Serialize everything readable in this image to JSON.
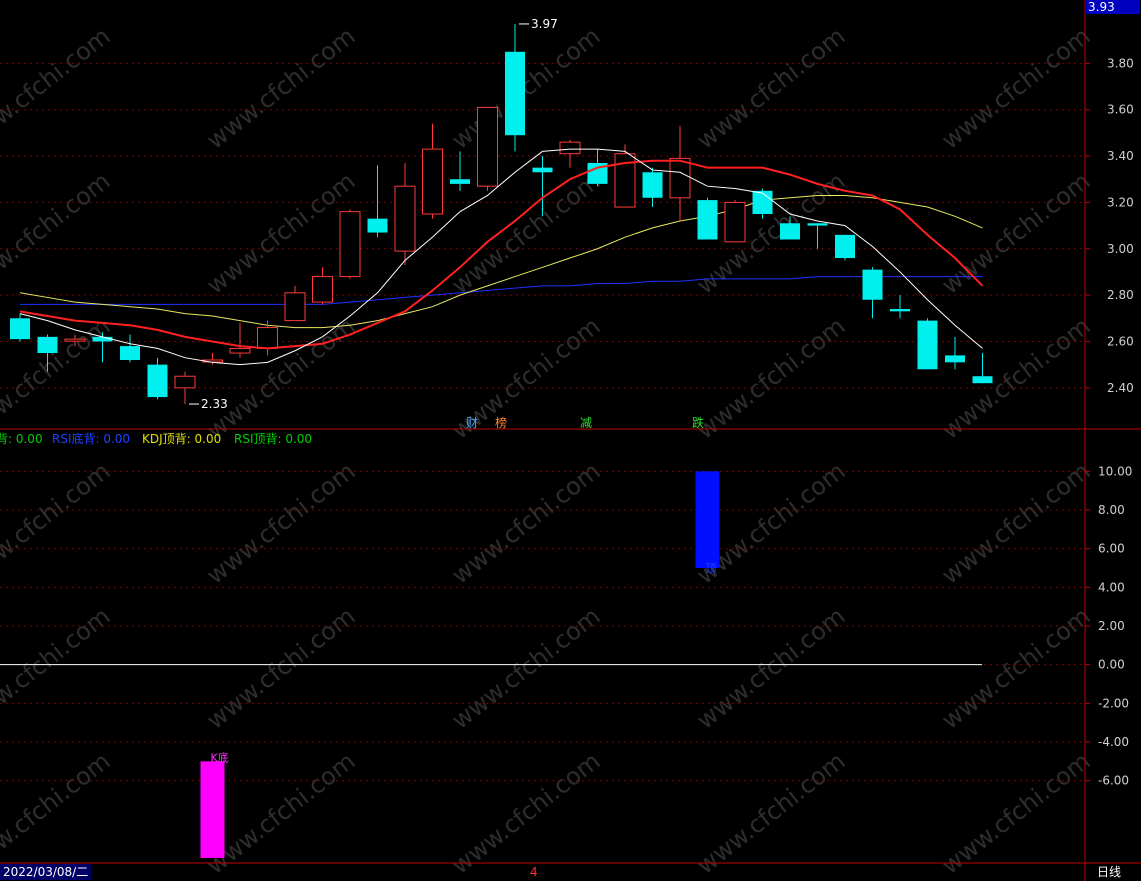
{
  "header": {
    "indicators": [
      {
        "label": "背: 0.00",
        "color": "#00d000"
      },
      {
        "label": "RSI底背: 0.00",
        "color": "#2040ff"
      },
      {
        "label": "KDJ顶背: 0.00",
        "color": "#e0e000"
      },
      {
        "label": "RSI顶背: 0.00",
        "color": "#00d000"
      }
    ]
  },
  "price_badge": "3.93",
  "news_tags": [
    {
      "label": "财",
      "color": "#4aa8ff"
    },
    {
      "label": "榜",
      "color": "#ff8030"
    },
    {
      "label": "减",
      "color": "#30e030"
    },
    {
      "label": "跌",
      "color": "#30e030"
    }
  ],
  "bottom_bar": {
    "date": "2022/03/08/二",
    "cursor_number": "4",
    "period": "日线"
  },
  "watermark": "www.cfchi.com",
  "colors": {
    "up": "#ff3b3b",
    "down": "#00f0f0",
    "ma5": "#ffffff",
    "ma10": "#ff2020",
    "ma20": "#e8e860",
    "ma60": "#2030ff",
    "grid": "#800000"
  },
  "chart_data": [
    {
      "type": "candlestick",
      "ylim": [
        2.3,
        4.0
      ],
      "ticks": [
        "3.80",
        "3.60",
        "3.40",
        "3.20",
        "3.00",
        "2.80",
        "2.60",
        "2.40"
      ],
      "tick_values": [
        3.8,
        3.6,
        3.4,
        3.2,
        3.0,
        2.8,
        2.6,
        2.4
      ],
      "annotations": [
        {
          "text": "3.97",
          "value": 3.97,
          "index": 18
        },
        {
          "text": "2.33",
          "value": 2.33,
          "index": 6
        }
      ],
      "candles": [
        {
          "o": 2.7,
          "c": 2.61,
          "h": 2.72,
          "l": 2.6
        },
        {
          "o": 2.62,
          "c": 2.55,
          "h": 2.63,
          "l": 2.47
        },
        {
          "o": 2.61,
          "c": 2.61,
          "h": 2.63,
          "l": 2.58
        },
        {
          "o": 2.62,
          "c": 2.6,
          "h": 2.64,
          "l": 2.51
        },
        {
          "o": 2.58,
          "c": 2.52,
          "h": 2.63,
          "l": 2.51
        },
        {
          "o": 2.5,
          "c": 2.36,
          "h": 2.53,
          "l": 2.35
        },
        {
          "o": 2.4,
          "c": 2.45,
          "h": 2.47,
          "l": 2.33
        },
        {
          "o": 2.52,
          "c": 2.52,
          "h": 2.55,
          "l": 2.5
        },
        {
          "o": 2.55,
          "c": 2.57,
          "h": 2.68,
          "l": 2.53
        },
        {
          "o": 2.57,
          "c": 2.66,
          "h": 2.69,
          "l": 2.54
        },
        {
          "o": 2.69,
          "c": 2.81,
          "h": 2.84,
          "l": 2.69
        },
        {
          "o": 2.77,
          "c": 2.88,
          "h": 2.92,
          "l": 2.76
        },
        {
          "o": 2.88,
          "c": 3.16,
          "h": 3.17,
          "l": 2.87
        },
        {
          "o": 3.13,
          "c": 3.07,
          "h": 3.36,
          "l": 3.05
        },
        {
          "o": 2.99,
          "c": 3.27,
          "h": 3.37,
          "l": 2.93
        },
        {
          "o": 3.15,
          "c": 3.43,
          "h": 3.54,
          "l": 3.13
        },
        {
          "o": 3.3,
          "c": 3.28,
          "h": 3.42,
          "l": 3.25
        },
        {
          "o": 3.27,
          "c": 3.61,
          "h": 3.61,
          "l": 3.25
        },
        {
          "o": 3.85,
          "c": 3.49,
          "h": 3.97,
          "l": 3.42
        },
        {
          "o": 3.35,
          "c": 3.33,
          "h": 3.4,
          "l": 3.14
        },
        {
          "o": 3.41,
          "c": 3.46,
          "h": 3.47,
          "l": 3.35
        },
        {
          "o": 3.37,
          "c": 3.28,
          "h": 3.43,
          "l": 3.27
        },
        {
          "o": 3.18,
          "c": 3.41,
          "h": 3.45,
          "l": 3.18
        },
        {
          "o": 3.33,
          "c": 3.22,
          "h": 3.35,
          "l": 3.18
        },
        {
          "o": 3.22,
          "c": 3.39,
          "h": 3.53,
          "l": 3.12
        },
        {
          "o": 3.21,
          "c": 3.04,
          "h": 3.22,
          "l": 3.04
        },
        {
          "o": 3.03,
          "c": 3.2,
          "h": 3.21,
          "l": 3.03
        },
        {
          "o": 3.25,
          "c": 3.15,
          "h": 3.26,
          "l": 3.13
        },
        {
          "o": 3.11,
          "c": 3.04,
          "h": 3.14,
          "l": 3.04
        },
        {
          "o": 3.11,
          "c": 3.1,
          "h": 3.11,
          "l": 3.0
        },
        {
          "o": 3.06,
          "c": 2.96,
          "h": 3.06,
          "l": 2.95
        },
        {
          "o": 2.91,
          "c": 2.78,
          "h": 2.92,
          "l": 2.7
        },
        {
          "o": 2.74,
          "c": 2.73,
          "h": 2.8,
          "l": 2.7
        },
        {
          "o": 2.69,
          "c": 2.48,
          "h": 2.7,
          "l": 2.48
        },
        {
          "o": 2.54,
          "c": 2.51,
          "h": 2.62,
          "l": 2.48
        },
        {
          "o": 2.45,
          "c": 2.42,
          "h": 2.55,
          "l": 2.42
        }
      ],
      "series": [
        {
          "name": "MA5",
          "color": "#ffffff",
          "values": [
            2.72,
            2.69,
            2.65,
            2.62,
            2.59,
            2.57,
            2.53,
            2.51,
            2.5,
            2.51,
            2.56,
            2.62,
            2.71,
            2.81,
            2.95,
            3.05,
            3.16,
            3.23,
            3.33,
            3.42,
            3.43,
            3.43,
            3.42,
            3.34,
            3.33,
            3.27,
            3.26,
            3.24,
            3.15,
            3.12,
            3.1,
            3.01,
            2.9,
            2.78,
            2.67,
            2.57
          ]
        },
        {
          "name": "MA10",
          "color": "#ff2020",
          "values": [
            2.73,
            2.71,
            2.69,
            2.68,
            2.67,
            2.65,
            2.62,
            2.6,
            2.58,
            2.57,
            2.58,
            2.59,
            2.63,
            2.68,
            2.73,
            2.82,
            2.92,
            3.03,
            3.12,
            3.22,
            3.3,
            3.35,
            3.37,
            3.38,
            3.38,
            3.35,
            3.35,
            3.35,
            3.32,
            3.28,
            3.25,
            3.23,
            3.17,
            3.06,
            2.96,
            2.84
          ]
        },
        {
          "name": "MA20",
          "color": "#e8e860",
          "values": [
            2.81,
            2.79,
            2.77,
            2.76,
            2.75,
            2.74,
            2.72,
            2.71,
            2.69,
            2.67,
            2.66,
            2.66,
            2.67,
            2.69,
            2.72,
            2.75,
            2.8,
            2.84,
            2.88,
            2.92,
            2.96,
            3.0,
            3.05,
            3.09,
            3.12,
            3.14,
            3.17,
            3.21,
            3.22,
            3.23,
            3.23,
            3.22,
            3.2,
            3.18,
            3.14,
            3.09
          ]
        },
        {
          "name": "MA60",
          "color": "#2030ff",
          "values": [
            2.76,
            2.76,
            2.76,
            2.76,
            2.76,
            2.76,
            2.76,
            2.76,
            2.76,
            2.76,
            2.76,
            2.76,
            2.77,
            2.78,
            2.79,
            2.8,
            2.81,
            2.82,
            2.83,
            2.84,
            2.84,
            2.85,
            2.85,
            2.86,
            2.86,
            2.87,
            2.87,
            2.87,
            2.87,
            2.88,
            2.88,
            2.88,
            2.88,
            2.88,
            2.88,
            2.88
          ]
        }
      ]
    },
    {
      "type": "bar",
      "ylim": [
        -10.0,
        11.0
      ],
      "ticks": [
        "10.00",
        "8.00",
        "6.00",
        "4.00",
        "2.00",
        "0.00",
        "-2.00",
        "-4.00",
        "-6.00"
      ],
      "tick_values": [
        10,
        8,
        6,
        4,
        2,
        0,
        -2,
        -4,
        -6
      ],
      "zero_line": 0,
      "bars": [
        {
          "index": 7,
          "from": -5.0,
          "to": -10.0,
          "color": "#ff00ff",
          "label": "K底",
          "label_color": "#ff30ff"
        },
        {
          "index": 25,
          "from": 10.0,
          "to": 5.0,
          "color": "#0010ff",
          "label": "顶",
          "label_color": "#2040ff"
        }
      ]
    }
  ]
}
